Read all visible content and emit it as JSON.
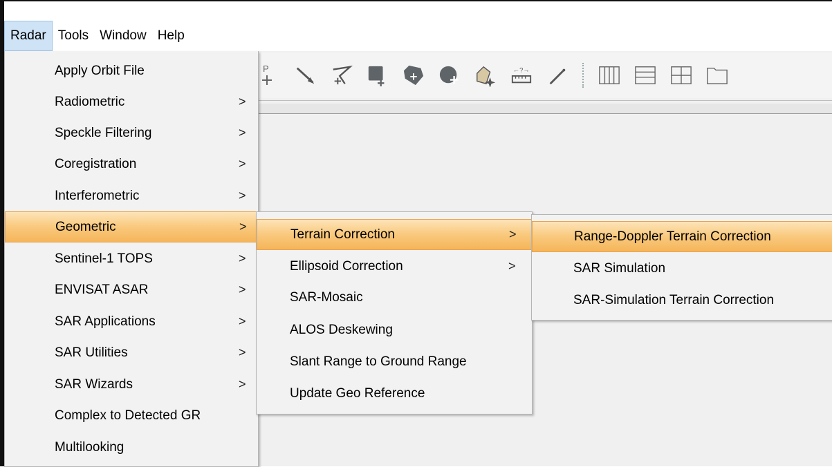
{
  "menubar": {
    "items": [
      {
        "label": "Radar"
      },
      {
        "label": "Tools"
      },
      {
        "label": "Window"
      },
      {
        "label": "Help"
      }
    ]
  },
  "toolbar": {
    "icons": [
      "gcp-add-icon",
      "line-draw-icon",
      "polyline-draw-icon",
      "rectangle-add-icon",
      "polygon-add-icon",
      "ellipse-add-icon",
      "select-magic-icon",
      "measure-range-icon",
      "magic-wand-icon",
      "tile-columns-icon",
      "tile-rows-icon",
      "tile-grid-icon",
      "folder-icon"
    ],
    "partial_text": "P"
  },
  "radar_menu": {
    "items": [
      {
        "label": "Apply Orbit File",
        "submenu": false
      },
      {
        "label": "Radiometric",
        "submenu": true
      },
      {
        "label": "Speckle Filtering",
        "submenu": true
      },
      {
        "label": "Coregistration",
        "submenu": true
      },
      {
        "label": "Interferometric",
        "submenu": true
      },
      {
        "label": "Geometric",
        "submenu": true,
        "highlighted": true
      },
      {
        "label": "Sentinel-1 TOPS",
        "submenu": true
      },
      {
        "label": "ENVISAT ASAR",
        "submenu": true
      },
      {
        "label": "SAR Applications",
        "submenu": true
      },
      {
        "label": "SAR Utilities",
        "submenu": true
      },
      {
        "label": "SAR Wizards",
        "submenu": true
      },
      {
        "label": "Complex to Detected GR",
        "submenu": false
      },
      {
        "label": "Multilooking",
        "submenu": false
      }
    ]
  },
  "geometric_menu": {
    "items": [
      {
        "label": "Terrain Correction",
        "submenu": true,
        "highlighted": true
      },
      {
        "label": "Ellipsoid Correction",
        "submenu": true
      },
      {
        "label": "SAR-Mosaic",
        "submenu": false
      },
      {
        "label": "ALOS Deskewing",
        "submenu": false
      },
      {
        "label": "Slant Range to Ground Range",
        "submenu": false
      },
      {
        "label": "Update Geo Reference",
        "submenu": false
      }
    ]
  },
  "terrain_menu": {
    "items": [
      {
        "label": "Range-Doppler Terrain Correction",
        "highlighted": true
      },
      {
        "label": "SAR Simulation"
      },
      {
        "label": "SAR-Simulation Terrain Correction"
      }
    ]
  },
  "submenu_arrow": ">",
  "colors": {
    "highlight_top": "#fde4b8",
    "highlight_bottom": "#f5b55a",
    "menubar_active": "#cfe3f6",
    "menu_bg": "#f2f2f2"
  }
}
